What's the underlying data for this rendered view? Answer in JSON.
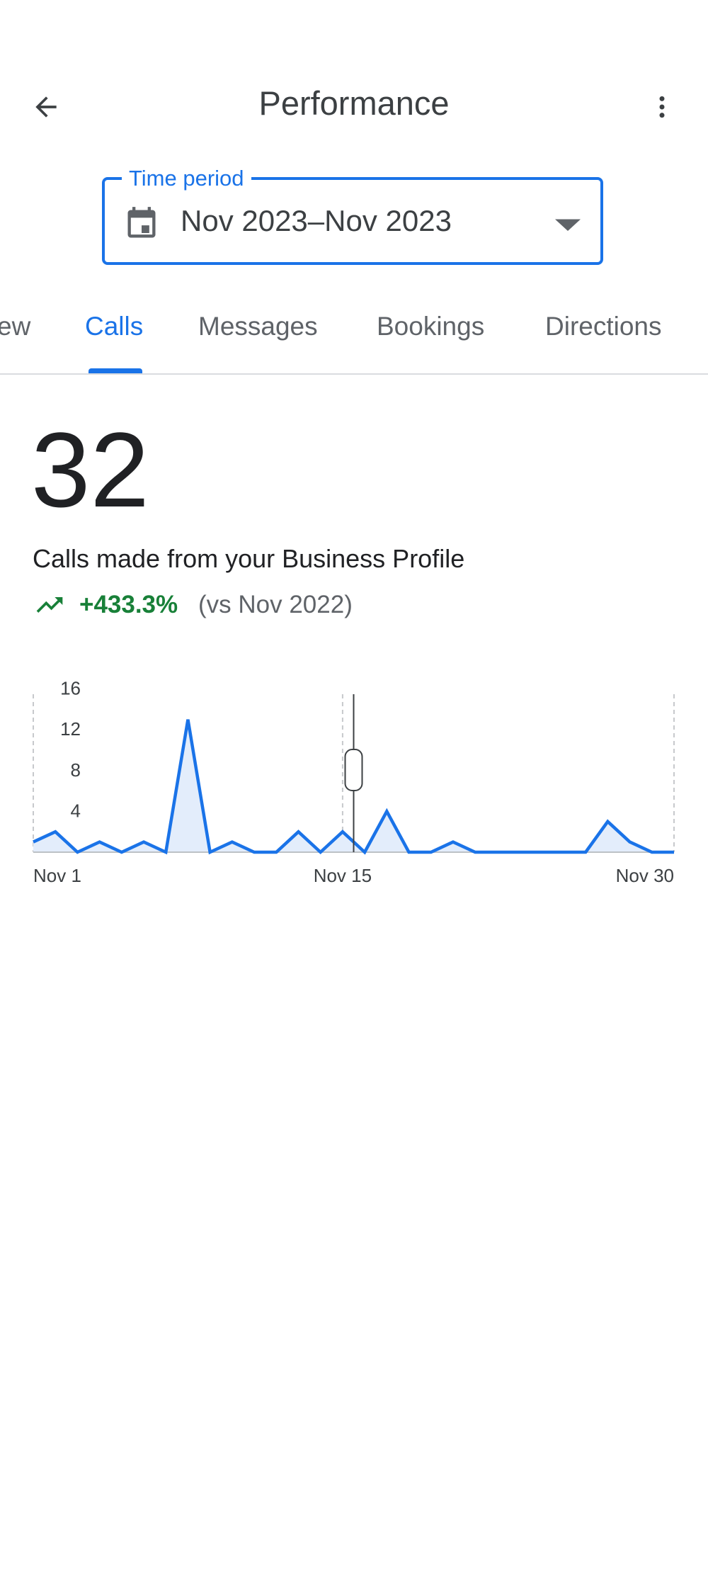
{
  "header": {
    "title": "Performance",
    "back_icon": "arrow-back-icon",
    "more_icon": "more-vert-icon"
  },
  "time_period": {
    "label": "Time period",
    "value": "Nov 2023–Nov 2023",
    "icon": "calendar-icon",
    "dropdown_icon": "dropdown-arrow-icon"
  },
  "tabs": [
    {
      "label": "ew",
      "active": false
    },
    {
      "label": "Calls",
      "active": true
    },
    {
      "label": "Messages",
      "active": false
    },
    {
      "label": "Bookings",
      "active": false
    },
    {
      "label": "Directions",
      "active": false
    }
  ],
  "metric": {
    "value": "32",
    "caption": "Calls made from your Business Profile",
    "trend_percent": "+433.3%",
    "trend_compare": "(vs Nov 2022)",
    "trend_icon": "trending-up-icon"
  },
  "colors": {
    "accent": "#1a73e8",
    "positive": "#188038",
    "chart_fill": "#e3edfb"
  },
  "chart_data": {
    "type": "area",
    "x": [
      1,
      2,
      3,
      4,
      5,
      6,
      7,
      8,
      9,
      10,
      11,
      12,
      13,
      14,
      15,
      16,
      17,
      18,
      19,
      20,
      21,
      22,
      23,
      24,
      25,
      26,
      27,
      28,
      29,
      30
    ],
    "series": [
      {
        "values": [
          1,
          2,
          0,
          1,
          0,
          1,
          0,
          13,
          0,
          1,
          0,
          0,
          2,
          0,
          2,
          0,
          4,
          0,
          0,
          1,
          0,
          0,
          0,
          0,
          0,
          0,
          3,
          1,
          0,
          0
        ]
      }
    ],
    "y_ticks": [
      "16",
      "12",
      "8",
      "4"
    ],
    "ylim": [
      0,
      16
    ],
    "x_tick_labels": [
      {
        "label": "Nov 1",
        "day": 1
      },
      {
        "label": "Nov 15",
        "day": 15
      },
      {
        "label": "Nov 30",
        "day": 30
      }
    ],
    "cursor_day": 15.5
  }
}
